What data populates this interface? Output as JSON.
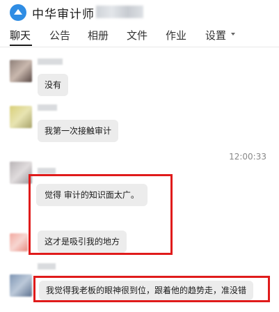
{
  "header": {
    "app_title": "中华审计师",
    "logo_icon": "graduation-cap-logo"
  },
  "tabs": [
    {
      "label": "聊天",
      "active": true
    },
    {
      "label": "公告"
    },
    {
      "label": "相册"
    },
    {
      "label": "文件"
    },
    {
      "label": "作业"
    },
    {
      "label": "设置"
    }
  ],
  "messages": [
    {
      "text": "没有"
    },
    {
      "text": "我第一次接触审计"
    },
    {
      "timestamp": "12:00:33"
    },
    {
      "text": "觉得  审计的知识面太广。"
    },
    {
      "text": "这才是吸引我的地方"
    },
    {
      "text": "我觉得我老板的眼神很到位，跟着他的趋势走，准没错"
    }
  ],
  "colors": {
    "highlight": "#e01b1b",
    "bubble": "#ececec",
    "logo": "#2f8de4"
  }
}
